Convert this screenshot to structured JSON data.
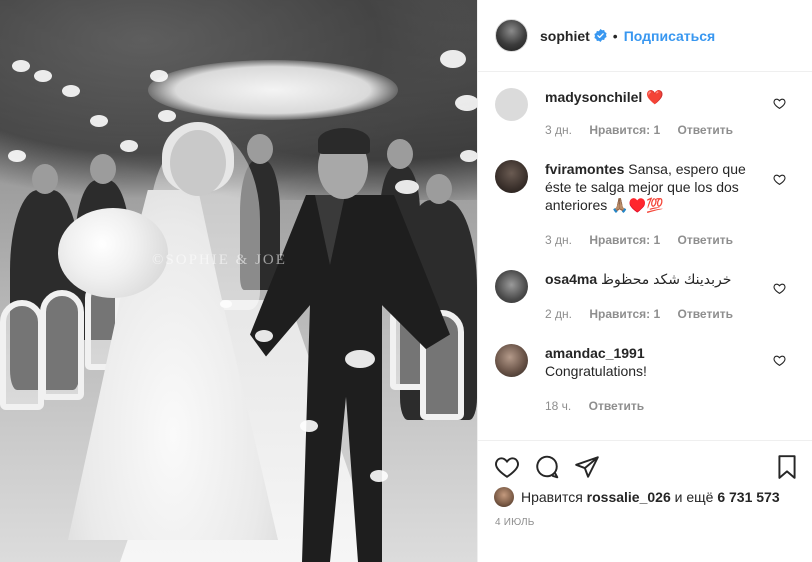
{
  "photo": {
    "watermark": "©SOPHIE & JOE"
  },
  "header": {
    "username": "sophiet",
    "separator": "•",
    "follow_label": "Подписаться"
  },
  "comments": [
    {
      "username": "madysonchilel",
      "text": "❤️",
      "time": "3 дн.",
      "likes": "Нравится: 1",
      "reply": "Ответить"
    },
    {
      "username": "fviramontes",
      "text": "Sansa, espero que éste te salga mejor que los dos anteriores 🙏🏽♥️💯",
      "time": "3 дн.",
      "likes": "Нравится: 1",
      "reply": "Ответить"
    },
    {
      "username": "osa4ma",
      "text": "خربدينك شكد محظوظ",
      "time": "2 дн.",
      "likes": "Нравится: 1",
      "reply": "Ответить"
    },
    {
      "username": "amandac_1991",
      "text": "Congratulations!",
      "time": "18 ч.",
      "reply": "Ответить"
    }
  ],
  "likes": {
    "prefix": "Нравится",
    "user": "rossalie_026",
    "middle": "и ещё",
    "count": "6 731 573"
  },
  "date": "4 ИЮЛЬ",
  "icons": {
    "like": "heart-outline-icon",
    "comment": "speech-bubble-icon",
    "share": "paper-plane-icon",
    "save": "bookmark-icon",
    "verified": "verified-badge-icon"
  },
  "colors": {
    "link": "#3897f0",
    "text": "#262626",
    "muted": "#8e8e8e",
    "verified": "#3897f0",
    "heart": "#ed4956"
  }
}
